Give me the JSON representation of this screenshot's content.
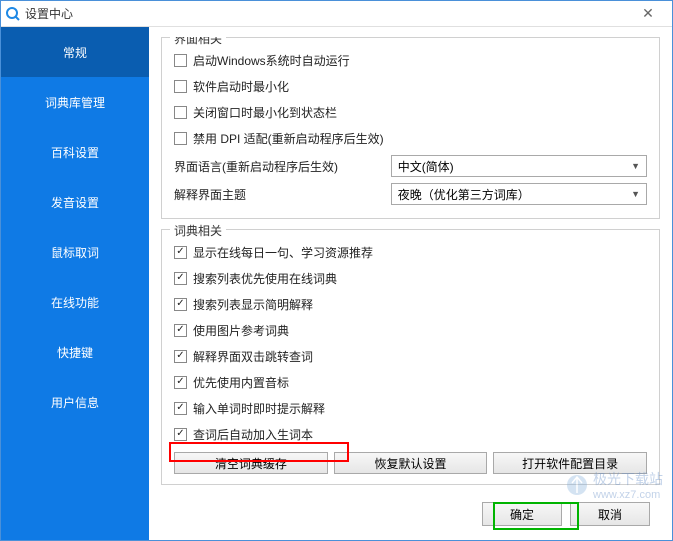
{
  "window": {
    "title": "设置中心"
  },
  "sidebar": {
    "items": [
      {
        "label": "常规"
      },
      {
        "label": "词典库管理"
      },
      {
        "label": "百科设置"
      },
      {
        "label": "发音设置"
      },
      {
        "label": "鼠标取词"
      },
      {
        "label": "在线功能"
      },
      {
        "label": "快捷键"
      },
      {
        "label": "用户信息"
      }
    ]
  },
  "groups": {
    "ui": {
      "title": "界面相关",
      "checks": [
        {
          "label": "启动Windows系统时自动运行",
          "checked": false
        },
        {
          "label": "软件启动时最小化",
          "checked": false
        },
        {
          "label": "关闭窗口时最小化到状态栏",
          "checked": false
        },
        {
          "label": "禁用 DPI 适配(重新启动程序后生效)",
          "checked": false
        }
      ],
      "lang_label": "界面语言(重新启动程序后生效)",
      "lang_value": "中文(简体)",
      "theme_label": "解释界面主题",
      "theme_value": "夜晚（优化第三方词库）"
    },
    "dict": {
      "title": "词典相关",
      "checks": [
        {
          "label": "显示在线每日一句、学习资源推荐",
          "checked": true
        },
        {
          "label": "搜索列表优先使用在线词典",
          "checked": true
        },
        {
          "label": "搜索列表显示简明解释",
          "checked": true
        },
        {
          "label": "使用图片参考词典",
          "checked": true
        },
        {
          "label": "解释界面双击跳转查词",
          "checked": true
        },
        {
          "label": "优先使用内置音标",
          "checked": true
        },
        {
          "label": "输入单词时即时提示解释",
          "checked": true
        },
        {
          "label": "查词后自动加入生词本",
          "checked": true
        }
      ],
      "buttons": [
        {
          "label": "清空词典缓存"
        },
        {
          "label": "恢复默认设置"
        },
        {
          "label": "打开软件配置目录"
        }
      ]
    }
  },
  "footer": {
    "ok": "确定",
    "cancel": "取消"
  },
  "watermark": {
    "line1": "极光下载站",
    "line2": "www.xz7.com"
  }
}
